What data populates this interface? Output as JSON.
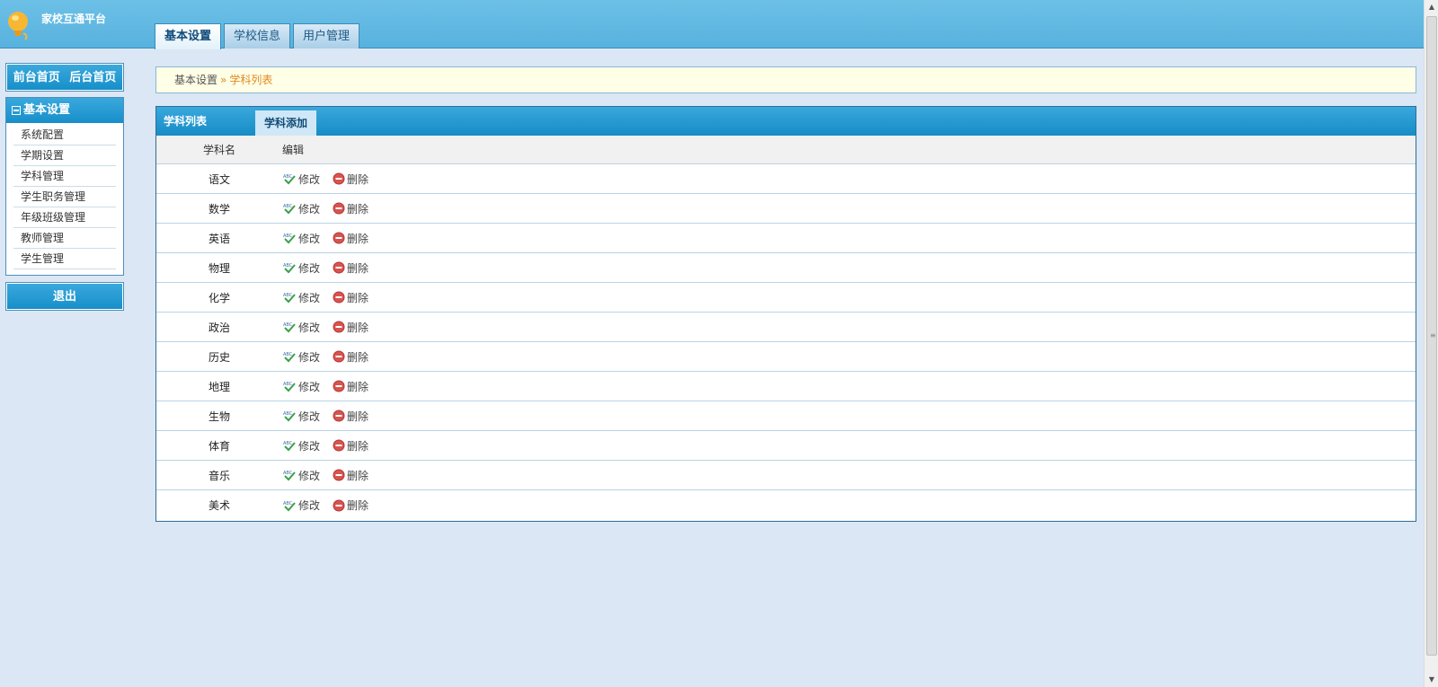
{
  "app": {
    "title": "家校互通平台"
  },
  "tabs": [
    {
      "label": "基本设置",
      "active": true
    },
    {
      "label": "学校信息",
      "active": false
    },
    {
      "label": "用户管理",
      "active": false
    }
  ],
  "sidebar": {
    "front_home": "前台首页",
    "back_home": "后台首页",
    "section_title": "基本设置",
    "items": [
      "系统配置",
      "学期设置",
      "学科管理",
      "学生职务管理",
      "年级班级管理",
      "教师管理",
      "学生管理"
    ],
    "logout": "退出"
  },
  "breadcrumb": {
    "parent": "基本设置",
    "separator": "»",
    "current": "学科列表"
  },
  "panel": {
    "title": "学科列表",
    "add_tab": "学科添加",
    "columns": {
      "name": "学科名",
      "edit": "编辑"
    },
    "edit_label": "修改",
    "delete_label": "删除",
    "rows": [
      "语文",
      "数学",
      "英语",
      "物理",
      "化学",
      "政治",
      "历史",
      "地理",
      "生物",
      "体育",
      "音乐",
      "美术"
    ]
  },
  "colors": {
    "header": "#5db5e0",
    "accent": "#1a90c9",
    "breadcrumb_current": "#e08a20",
    "background": "#dbe7f4"
  }
}
